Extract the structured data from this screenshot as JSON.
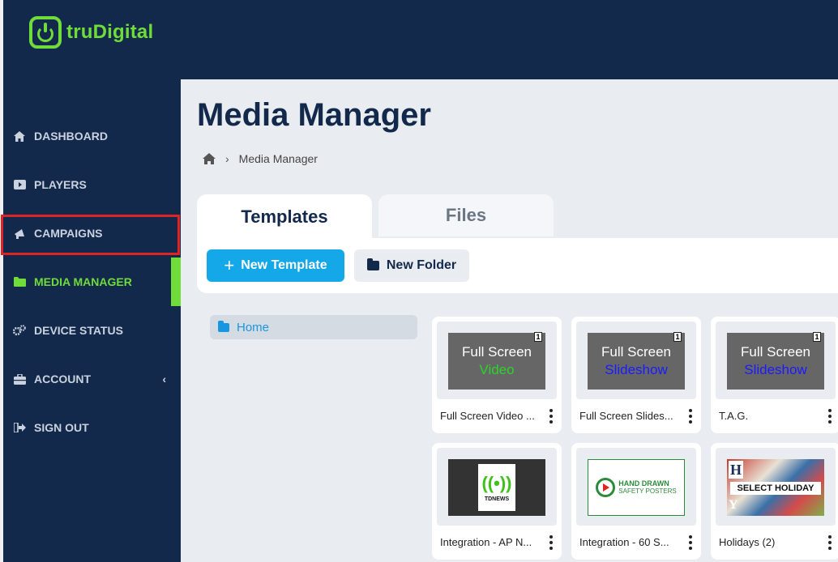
{
  "app": {
    "logo_text": "truDigital"
  },
  "sidebar": {
    "items": [
      {
        "label": "DASHBOARD",
        "icon": "home-icon"
      },
      {
        "label": "PLAYERS",
        "icon": "play-icon"
      },
      {
        "label": "CAMPAIGNS",
        "icon": "megaphone-icon"
      },
      {
        "label": "MEDIA MANAGER",
        "icon": "folder-icon",
        "active": true
      },
      {
        "label": "DEVICE STATUS",
        "icon": "gears-icon"
      },
      {
        "label": "ACCOUNT",
        "icon": "briefcase-icon"
      },
      {
        "label": "SIGN OUT",
        "icon": "sign-out-icon"
      }
    ]
  },
  "page": {
    "title": "Media Manager",
    "breadcrumb": "Media Manager"
  },
  "tabs": [
    {
      "label": "Templates"
    },
    {
      "label": "Files"
    }
  ],
  "toolbar": {
    "new_template": "New Template",
    "new_folder": "New Folder"
  },
  "tree": {
    "home": "Home"
  },
  "cards": [
    {
      "label": "Full Screen Video ...",
      "line1": "Full Screen",
      "line2": "Video",
      "badge": "1"
    },
    {
      "label": "Full Screen Slides...",
      "line1": "Full Screen",
      "line2": "Slideshow",
      "badge": "1"
    },
    {
      "label": "T.A.G.",
      "line1": "Full Screen",
      "line2": "Slideshow",
      "badge": "1"
    },
    {
      "label": "Integration - AP N...",
      "thumb_text": "TDNEWS"
    },
    {
      "label": "Integration - 60 S...",
      "thumb_t1": "HAND DRAWN",
      "thumb_t2": "SAFETY POSTERS"
    },
    {
      "label": "Holidays (2)",
      "thumb_text": "SELECT HOLIDAY",
      "thumb_h": "H",
      "thumb_y": "Y"
    }
  ],
  "colors": {
    "navy": "#13294b",
    "green": "#6fdc3a",
    "blue": "#15a8e8",
    "highlight": "#e02424"
  }
}
